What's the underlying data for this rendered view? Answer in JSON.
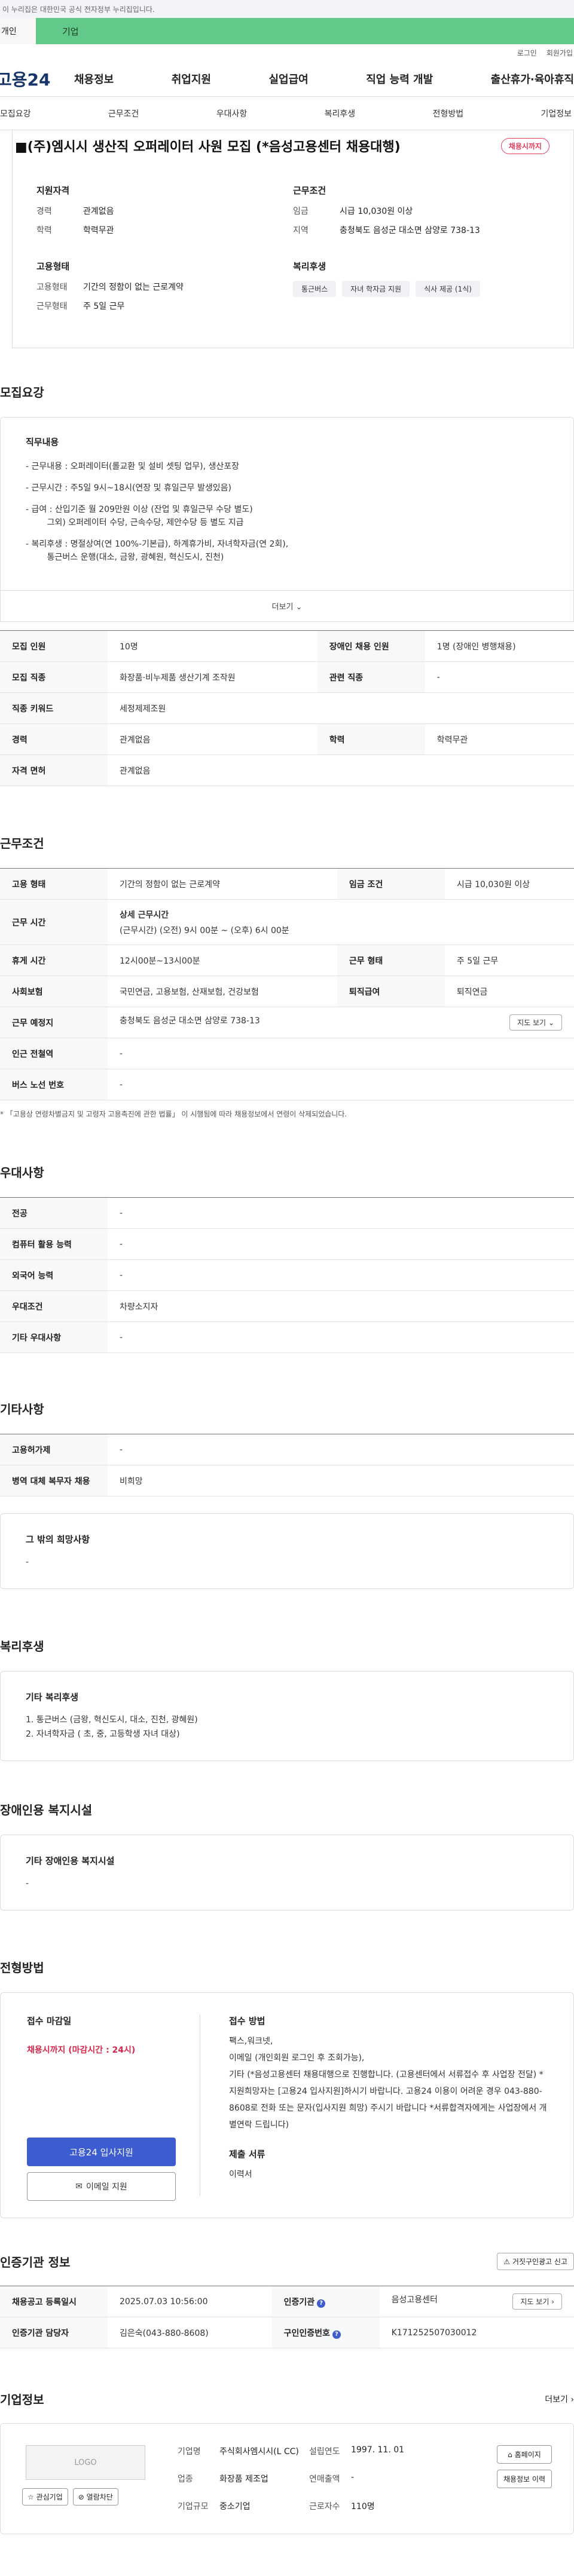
{
  "gov_bar": "이 누리집은 대한민국 공식 전자정부 누리집입니다.",
  "tabs": {
    "person": "개인",
    "biz": "기업"
  },
  "util": {
    "login": "로그인",
    "join": "회원가입"
  },
  "logo": "고용24",
  "gnb": [
    "채용정보",
    "취업지원",
    "실업급여",
    "직업 능력 개발",
    "출산휴가·육아휴직"
  ],
  "subnav": [
    "모집요강",
    "근무조건",
    "우대사항",
    "복리후생",
    "전형방법",
    "기업정보"
  ],
  "title": "(주)엠시시 생산직 오퍼레이터 사원 모집 (*음성고용센터 채용대행)",
  "badge": "채용시까지",
  "summary": {
    "qual_head": "지원자격",
    "qual": [
      {
        "k": "경력",
        "v": "관계없음"
      },
      {
        "k": "학력",
        "v": "학력무관"
      }
    ],
    "cond_head": "근무조건",
    "cond": [
      {
        "k": "임금",
        "v": "시급 10,030원 이상"
      },
      {
        "k": "지역",
        "v": "충청북도 음성군 대소면 삼양로 738-13"
      }
    ],
    "emp_head": "고용형태",
    "emp": [
      {
        "k": "고용형태",
        "v": "기간의 정함이 없는 근로계약"
      },
      {
        "k": "근무형태",
        "v": "주 5일 근무"
      }
    ],
    "welfare_head": "복리후생",
    "welfare_chips": [
      "통근버스",
      "자녀 학자금 지원",
      "식사 제공 (1식)"
    ]
  },
  "req": {
    "section": "모집요강",
    "head": "직무내용",
    "lines": [
      "- 근무내용 : 오퍼레이터(롤교환 및 설비 셋팅 업무), 생산포장",
      "- 근무시간 : 주5일 9시~18시(연장 및 휴일근무 발생있음)",
      "- 급여 : 산입기준 월 209만원 이상 (잔업 및 휴일근무 수당 별도)\n        그외) 오퍼레이터 수당, 근속수당, 제안수당 등 별도 지급",
      "- 복리후생 : 명절상여(연 100%-기본급), 하계휴가비, 자녀학자금(연 2회),\n        통근버스 운행(대소, 금왕, 광혜원, 혁신도시, 진천)"
    ],
    "more": "더보기",
    "table": [
      [
        {
          "k": "모집 인원",
          "v": "10명"
        },
        {
          "k": "장애인 채용 인원",
          "v": "1명 (장애인 병행채용)"
        }
      ],
      [
        {
          "k": "모집 직종",
          "v": "화장품·비누제품 생산기계 조작원"
        },
        {
          "k": "관련 직종",
          "v": "-"
        }
      ],
      [
        {
          "k": "직종 키워드",
          "v": "세정제제조원"
        }
      ],
      [
        {
          "k": "경력",
          "v": "관계없음"
        },
        {
          "k": "학력",
          "v": "학력무관"
        }
      ],
      [
        {
          "k": "자격 면허",
          "v": "관계없음"
        }
      ]
    ]
  },
  "work": {
    "section": "근무조건",
    "emp_type_k": "고용 형태",
    "emp_type_v": "기간의 정함이 없는 근로계약",
    "wage_k": "임금 조건",
    "wage_v": "시급 10,030원 이상",
    "time_k": "근무 시간",
    "time_head": "상세 근무시간",
    "time_v": "(근무시간) (오전) 9시 00분 ~ (오후) 6시 00분",
    "rest_k": "휴게 시간",
    "rest_v": "12시00분~13시00분",
    "form_k": "근무 형태",
    "form_v": "주 5일 근무",
    "ins_k": "사회보험",
    "ins_v": "국민연금, 고용보험, 산재보험, 건강보험",
    "ret_k": "퇴직급여",
    "ret_v": "퇴직연금",
    "place_k": "근무 예정지",
    "place_v": "충청북도 음성군 대소면 삼양로 738-13",
    "map": "지도 보기",
    "subway_k": "인근 전철역",
    "subway_v": "-",
    "bus_k": "버스 노선 번호",
    "bus_v": "-",
    "note": "* 「고용상 연령차별금지 및 고령자 고용촉진에 관한 법률」 이 시행됨에 따라 채용정보에서 연령이 삭제되었습니다."
  },
  "pref": {
    "section": "우대사항",
    "rows": [
      {
        "k": "전공",
        "v": "-"
      },
      {
        "k": "컴퓨터 활용 능력",
        "v": "-"
      },
      {
        "k": "외국어 능력",
        "v": "-"
      },
      {
        "k": "우대조건",
        "v": "차량소지자"
      },
      {
        "k": "기타 우대사항",
        "v": "-"
      }
    ]
  },
  "etc": {
    "section": "기타사항",
    "rows": [
      {
        "k": "고용허가제",
        "v": "-"
      },
      {
        "k": "병역 대체 복무자 채용",
        "v": "비희망"
      }
    ],
    "box_head": "그 밖의 희망사항",
    "box_val": "-"
  },
  "welfare": {
    "section": "복리후생",
    "head": "기타 복리후생",
    "lines": [
      "1. 통근버스 (금왕, 혁신도시, 대소, 진천, 광혜원)",
      "2. 자녀학자금 ( 초, 중, 고등학생 자녀 대상)"
    ]
  },
  "disab": {
    "section": "장애인용 복지시설",
    "head": "기타 장애인용 복지시설",
    "val": "-"
  },
  "apply": {
    "section": "전형방법",
    "deadline_head": "접수 마감일",
    "deadline": "채용시까지 (마감시간 : 24시)",
    "btn_apply": "고용24 입사지원",
    "btn_email": "이메일 지원",
    "method_head": "접수 방법",
    "method": "팩스,워크넷,\n이메일 (개인회원 로그인 후 조회가능),\n기타 (*음성고용센터 채용대행으로 진행합니다. (고용센터에서 서류접수 후 사업장 전달) *지원희망자는 [고용24 입사지원]하시기 바랍니다. 고용24 이용이 어려운 경우 043-880-8608로 전화 또는 문자(입사지원 희망) 주시기 바랍니다 *서류합격자에게는 사업장에서 개별연락 드립니다)",
    "docs_head": "제출 서류",
    "docs": "이력서"
  },
  "org": {
    "section": "인증기관 정보",
    "report_btn": "거짓구인광고 신고",
    "rows": [
      [
        {
          "k": "채용공고 등록일시",
          "v": "2025.07.03 10:56:00"
        },
        {
          "k": "인증기관",
          "v": "음성고용센터"
        }
      ],
      [
        {
          "k": "인증기관 담당자",
          "v": "김은숙(043-880-8608)"
        },
        {
          "k": "구인인증번호",
          "v": "K171252507030012"
        }
      ]
    ],
    "map": "지도 보기"
  },
  "company": {
    "section": "기업정보",
    "more": "더보기",
    "logo": "LOGO",
    "interest": "관심기업",
    "block": "열람차단",
    "fields": [
      {
        "k": "기업명",
        "v": "주식회사엠시시(L CC)"
      },
      {
        "k": "설립연도",
        "v": "1997. 11. 01"
      },
      {
        "k": "업종",
        "v": "화장품 제조업"
      },
      {
        "k": "연매출액",
        "v": "-"
      },
      {
        "k": "기업규모",
        "v": "중소기업"
      },
      {
        "k": "근로자수",
        "v": "110명"
      }
    ],
    "homepage": "홈페이지",
    "recruit_history": "채용정보 이력"
  }
}
